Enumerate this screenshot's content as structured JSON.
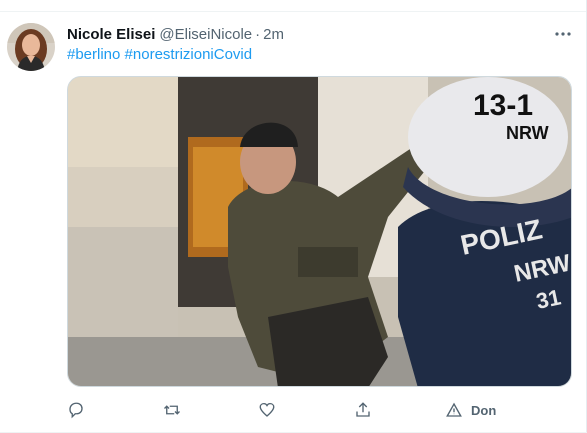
{
  "tweet": {
    "author_name": "Nicole Elisei",
    "author_handle": "@EliseiNicole",
    "separator": "·",
    "time": "2m",
    "hashtags": [
      "#berlino",
      "#norestrizioniCovid"
    ]
  },
  "media": {
    "helmet_text": "13-1",
    "helmet_sub": "NRW",
    "vest_text": "POLIZ",
    "vest_sub": "NRW",
    "vest_num": "31"
  },
  "actions": {
    "reply_icon": "reply-icon",
    "retweet_icon": "retweet-icon",
    "like_icon": "heart-icon",
    "share_icon": "share-icon",
    "donate_icon": "donate-icon",
    "donate_label": "Don"
  },
  "colors": {
    "accent": "#1d9bf0",
    "text_primary": "#0f1419",
    "text_secondary": "#536471"
  }
}
